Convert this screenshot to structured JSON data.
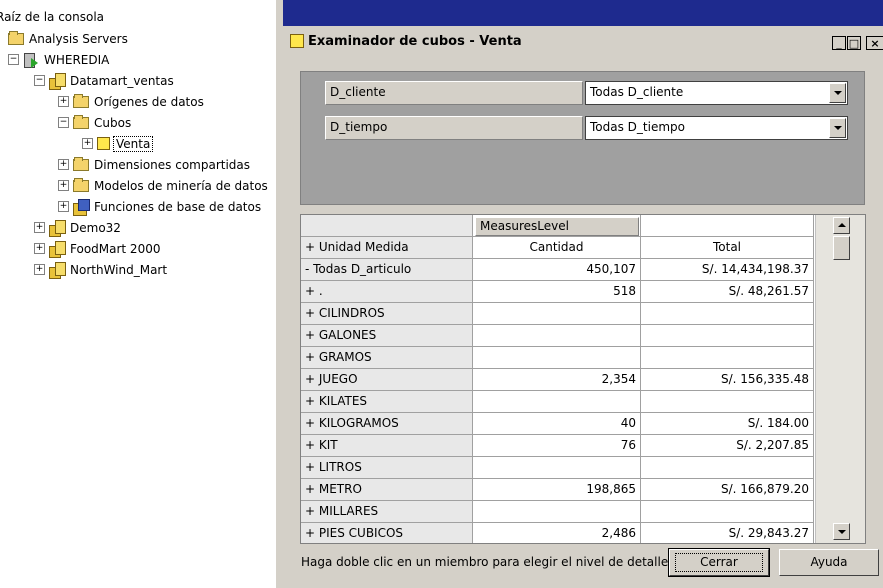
{
  "tree": {
    "root": "Raíz de la consola",
    "nodes": [
      {
        "label": "Analysis Servers",
        "icon": "folder-icon"
      },
      {
        "label": "WHEREDIA",
        "icon": "server-icon"
      },
      {
        "label": "Datamart_ventas",
        "icon": "database-icon"
      },
      {
        "label": "Orígenes de datos",
        "icon": "folder-icon"
      },
      {
        "label": "Cubos",
        "icon": "folder-icon"
      },
      {
        "label": "Venta",
        "icon": "cube-icon"
      },
      {
        "label": "Dimensiones compartidas",
        "icon": "folder-icon"
      },
      {
        "label": "Modelos de minería de datos",
        "icon": "folder-icon"
      },
      {
        "label": "Funciones de base de datos",
        "icon": "functions-icon"
      },
      {
        "label": "Demo32",
        "icon": "database-icon"
      },
      {
        "label": "FoodMart 2000",
        "icon": "database-icon"
      },
      {
        "label": "NorthWind_Mart",
        "icon": "database-icon"
      }
    ]
  },
  "dialog": {
    "title": "Examinador de cubos - Venta",
    "window_buttons": {
      "minimize": "_",
      "maximize": "□",
      "close": "×"
    },
    "filters": [
      {
        "label": "D_cliente",
        "value": "Todas D_cliente"
      },
      {
        "label": "D_tiempo",
        "value": "Todas D_tiempo"
      }
    ],
    "grid": {
      "measures_level": "MeasuresLevel",
      "row_dim": "+ Unidad Medida",
      "columns": [
        "Cantidad",
        "Total"
      ],
      "rows": [
        {
          "label": "- Todas D_articulo",
          "cantidad": "450,107",
          "total": "S/. 14,434,198.37"
        },
        {
          "label": "+ .",
          "cantidad": "518",
          "total": "S/. 48,261.57"
        },
        {
          "label": "+ CILINDROS",
          "cantidad": "",
          "total": ""
        },
        {
          "label": "+ GALONES",
          "cantidad": "",
          "total": ""
        },
        {
          "label": "+ GRAMOS",
          "cantidad": "",
          "total": ""
        },
        {
          "label": "+ JUEGO",
          "cantidad": "2,354",
          "total": "S/. 156,335.48"
        },
        {
          "label": "+ KILATES",
          "cantidad": "",
          "total": ""
        },
        {
          "label": "+ KILOGRAMOS",
          "cantidad": "40",
          "total": "S/. 184.00"
        },
        {
          "label": "+ KIT",
          "cantidad": "76",
          "total": "S/. 2,207.85"
        },
        {
          "label": "+ LITROS",
          "cantidad": "",
          "total": ""
        },
        {
          "label": "+ METRO",
          "cantidad": "198,865",
          "total": "S/. 166,879.20"
        },
        {
          "label": "+ MILLARES",
          "cantidad": "",
          "total": ""
        },
        {
          "label": "+ PIES CUBICOS",
          "cantidad": "2,486",
          "total": "S/. 29,843.27"
        }
      ]
    },
    "hint": "Haga doble clic en un miembro para elegir el nivel de detalle.",
    "close_button": "Cerrar",
    "help_button": "Ayuda"
  }
}
